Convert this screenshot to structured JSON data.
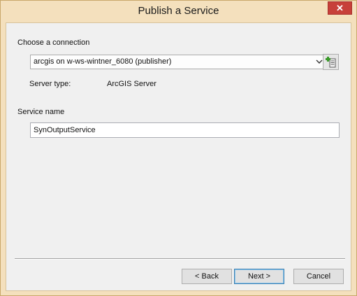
{
  "window": {
    "title": "Publish a Service"
  },
  "connection": {
    "label": "Choose a connection",
    "selected": "arcgis on w-ws-wintner_6080 (publisher)",
    "server_type_label": "Server type:",
    "server_type_value": "ArcGIS Server"
  },
  "service": {
    "name_label": "Service name",
    "name_value": "SynOutputService"
  },
  "buttons": {
    "back": "< Back",
    "next": "Next >",
    "cancel": "Cancel"
  }
}
